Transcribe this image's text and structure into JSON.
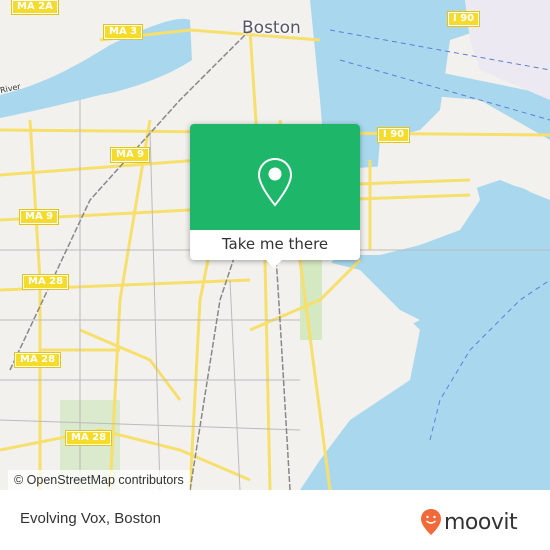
{
  "map": {
    "city_label": "Boston",
    "river_label": "River",
    "shields": [
      {
        "label": "MA 2A"
      },
      {
        "label": "MA 3"
      },
      {
        "label": "I 90"
      },
      {
        "label": "I 90"
      },
      {
        "label": "MA 9"
      },
      {
        "label": "MA 9"
      },
      {
        "label": "MA 28"
      },
      {
        "label": "MA 28"
      },
      {
        "label": "MA 28"
      }
    ],
    "attribution": "© OpenStreetMap contributors",
    "colors": {
      "water": "#a9d8ee",
      "land": "#f2f1ed",
      "road": "#f7df6c",
      "park": "#d4e8c2"
    }
  },
  "popup": {
    "icon": "location-pin-icon",
    "action_label": "Take me there",
    "color": "#1eb76a"
  },
  "footer": {
    "place_name": "Evolving Vox, Boston",
    "brand": "moovit",
    "brand_color": "#f26a3a"
  }
}
